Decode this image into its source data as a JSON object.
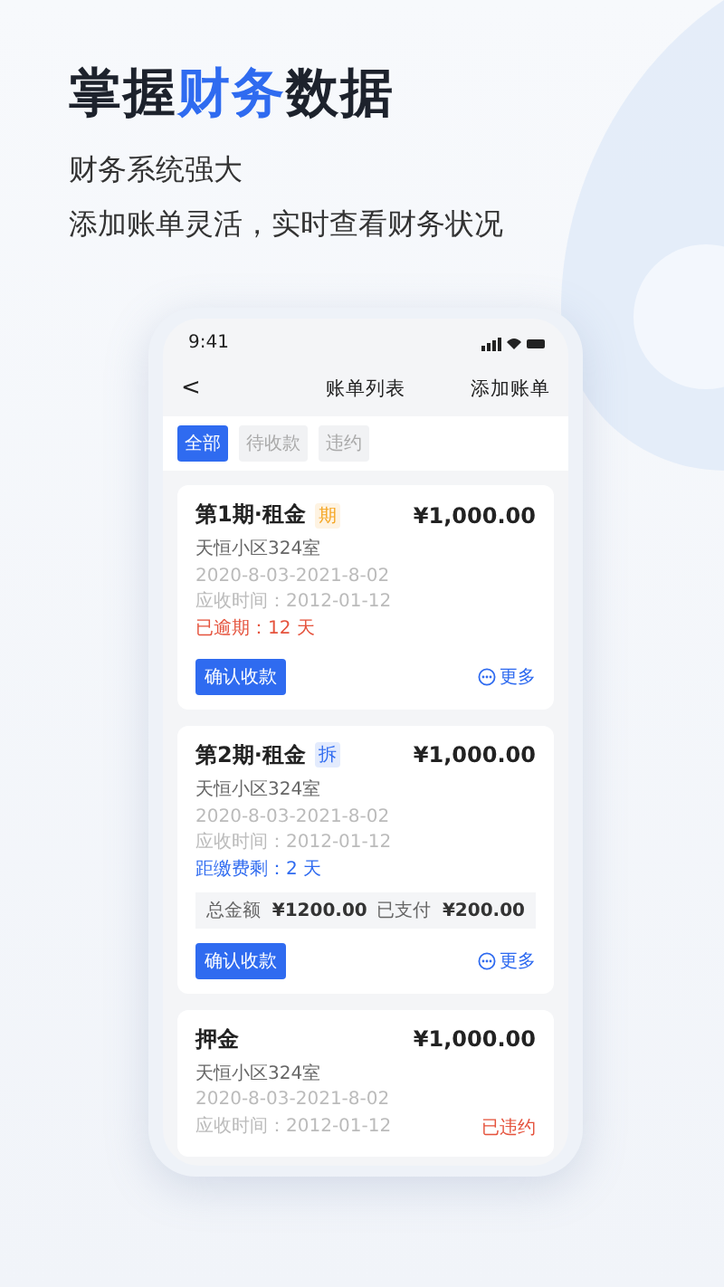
{
  "headline": [
    {
      "text": "掌握",
      "highlight": false
    },
    {
      "text": "财务",
      "highlight": true
    },
    {
      "text": "数据",
      "highlight": false
    }
  ],
  "subtitles": [
    "财务系统强大",
    "添加账单灵活，实时查看财务状况"
  ],
  "status_bar": {
    "time": "9:41"
  },
  "nav": {
    "back": "<",
    "title": "账单列表",
    "action": "添加账单"
  },
  "filters": [
    {
      "label": "全部",
      "selected": true
    },
    {
      "label": "待收款",
      "selected": false
    },
    {
      "label": "违约",
      "selected": false
    }
  ],
  "bills": [
    {
      "title": "第1期·租金",
      "tag": {
        "text": "期",
        "color": "#f5a623"
      },
      "amount": "¥1,000.00",
      "address": "天恒小区324室",
      "period": "2020-8-03-2021-8-02",
      "due": "应收时间：2012-01-12",
      "notice": {
        "text": "已逾期：12 天",
        "kind": "overdue"
      },
      "button": "确认收款",
      "more": "更多"
    },
    {
      "title": "第2期·租金",
      "tag": {
        "text": "拆",
        "color": "#2f6bf0"
      },
      "amount": "¥1,000.00",
      "address": "天恒小区324室",
      "period": "2020-8-03-2021-8-02",
      "due": "应收时间：2012-01-12",
      "notice": {
        "text": "距缴费剩：2 天",
        "kind": "countdown"
      },
      "summary": {
        "total_label": "总金额",
        "total": "¥1200.00",
        "paid_label": "已支付",
        "paid": "¥200.00"
      },
      "button": "确认收款",
      "more": "更多"
    },
    {
      "title": "押金",
      "amount": "¥1,000.00",
      "address": "天恒小区324室",
      "period": "2020-8-03-2021-8-02",
      "due": "应收时间：2012-01-12",
      "status": "已违约"
    }
  ]
}
